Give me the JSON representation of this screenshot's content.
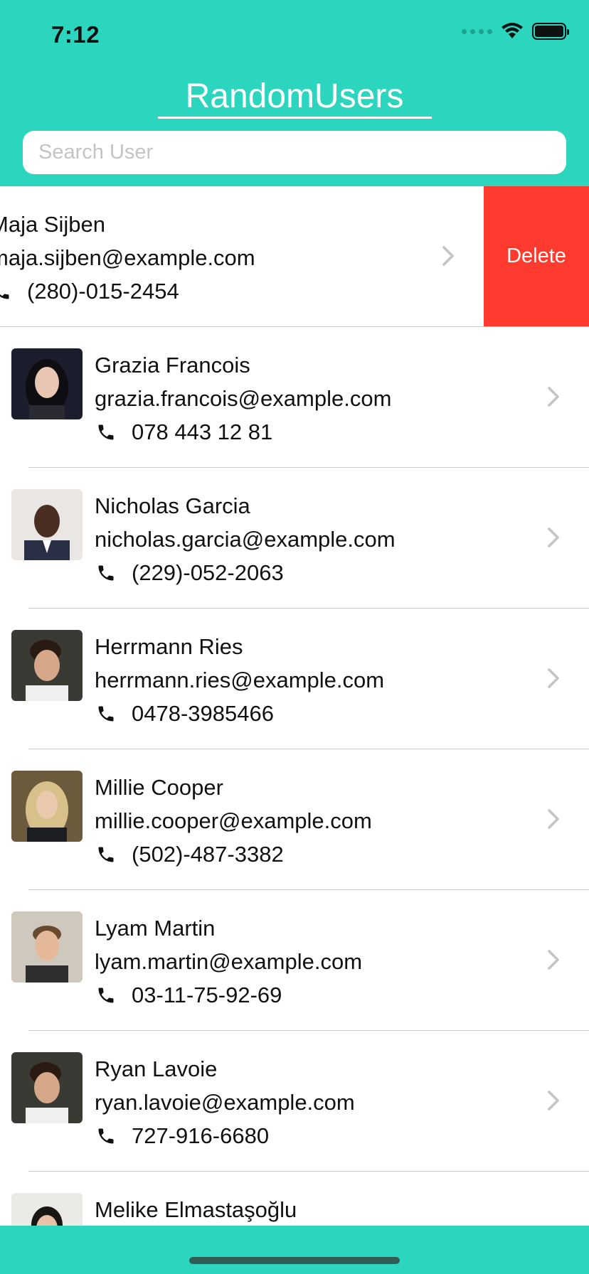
{
  "status_bar": {
    "time": "7:12"
  },
  "header": {
    "title": "RandomUsers",
    "background_color": "#2cd6be"
  },
  "search": {
    "placeholder": "Search User",
    "value": ""
  },
  "swiped_user": {
    "name": "Maja Sijben",
    "email": "maja.sijben@example.com",
    "phone": "(280)-015-2454",
    "delete_label": "Delete",
    "delete_color": "#ff3b30"
  },
  "users": [
    {
      "name": "Grazia Francois",
      "email": "grazia.francois@example.com",
      "phone": "078 443 12 81",
      "avatar": "woman-dark-hair"
    },
    {
      "name": "Nicholas Garcia",
      "email": "nicholas.garcia@example.com",
      "phone": "(229)-052-2063",
      "avatar": "man-suit"
    },
    {
      "name": "Herrmann Ries",
      "email": "herrmann.ries@example.com",
      "phone": "0478-3985466",
      "avatar": "man-smiling"
    },
    {
      "name": "Millie Cooper",
      "email": "millie.cooper@example.com",
      "phone": "(502)-487-3382",
      "avatar": "woman-blonde"
    },
    {
      "name": "Lyam Martin",
      "email": "lyam.martin@example.com",
      "phone": "03-11-75-92-69",
      "avatar": "man-beard"
    },
    {
      "name": "Ryan Lavoie",
      "email": "ryan.lavoie@example.com",
      "phone": "727-916-6680",
      "avatar": "man-smiling"
    },
    {
      "name": "Melike Elmastaşoğlu",
      "email": "",
      "phone": "",
      "avatar": "woman-dark-hair"
    }
  ],
  "icons": {
    "phone": "phone-icon",
    "chevron": "chevron-right-icon",
    "wifi": "wifi-icon",
    "battery": "battery-icon"
  }
}
